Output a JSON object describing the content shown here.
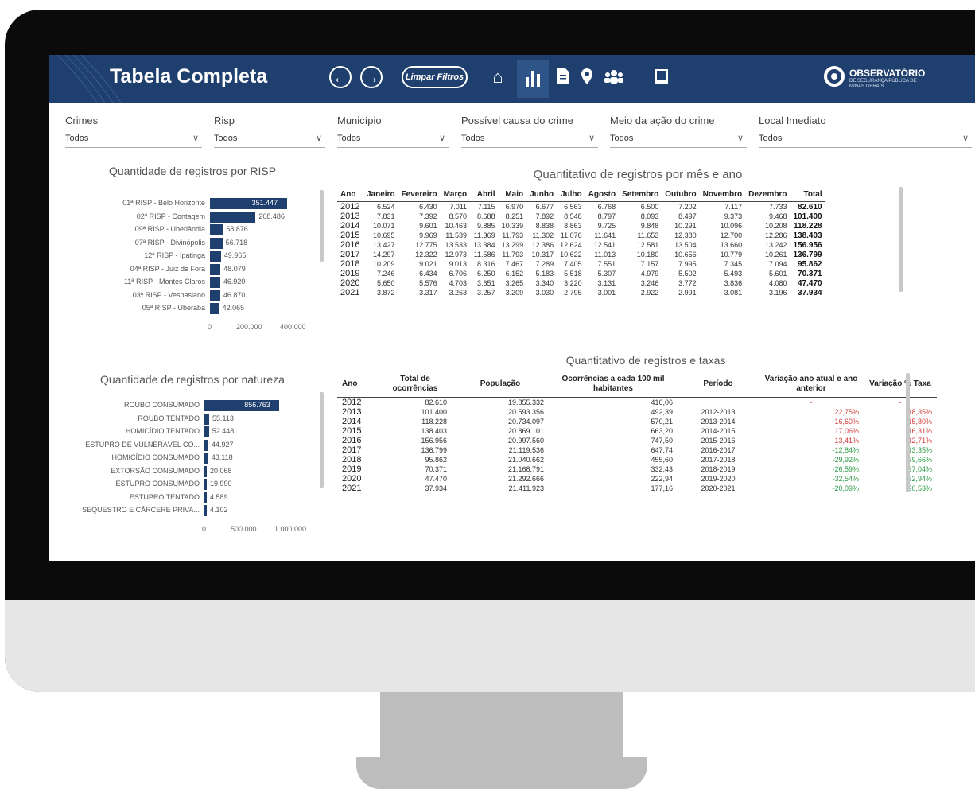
{
  "header": {
    "title": "Tabela Completa",
    "back_icon": "arrow-left-icon",
    "forward_icon": "arrow-right-icon",
    "clear_filters_label": "Limpar Filtros",
    "nav_icons": [
      "home-icon",
      "bar-chart-icon",
      "document-icon",
      "map-pin-icon",
      "people-icon",
      "book-icon"
    ],
    "brand_name": "OBSERVATÓRIO",
    "brand_sub": "DE SEGURANÇA PÚBLICA DE MINAS GERAIS",
    "colors": {
      "header_bg": "#1f3f6e",
      "bar": "#1f3f6e",
      "negative": "#2e9a45",
      "positive": "#d23a3a"
    }
  },
  "filters": [
    {
      "label": "Crimes",
      "value": "Todos"
    },
    {
      "label": "Risp",
      "value": "Todos"
    },
    {
      "label": "Município",
      "value": "Todos"
    },
    {
      "label": "Possível causa do crime",
      "value": "Todos"
    },
    {
      "label": "Meio da ação do crime",
      "value": "Todos"
    },
    {
      "label": "Local Imediato",
      "value": "Todos"
    }
  ],
  "chart_data": [
    {
      "type": "bar",
      "title": "Quantidade de registros por RISP",
      "orientation": "horizontal",
      "categories": [
        "01ª RISP - Belo Horizonte",
        "02ª RISP - Contagem",
        "09ª RISP - Uberlândia",
        "07ª RISP - Divinópolis",
        "12ª RISP - Ipatinga",
        "04ª RISP - Juiz de Fora",
        "11ª RISP - Montes Claros",
        "03ª RISP - Vespasiano",
        "05ª RISP - Uberaba"
      ],
      "values": [
        351447,
        208486,
        58876,
        56718,
        49965,
        48079,
        46920,
        46870,
        42065
      ],
      "value_labels": [
        "351.447",
        "208.486",
        "58.876",
        "56.718",
        "49.965",
        "48.079",
        "46.920",
        "46.870",
        "42.065"
      ],
      "xlim": [
        0,
        400000
      ],
      "ticks": [
        "0",
        "200.000",
        "400.000"
      ]
    },
    {
      "type": "bar",
      "title": "Quantidade de registros por natureza",
      "orientation": "horizontal",
      "categories": [
        "ROUBO CONSUMADO",
        "ROUBO TENTADO",
        "HOMICÍDIO TENTADO",
        "ESTUPRO DE VULNERÁVEL CO...",
        "HOMICÍDIO CONSUMADO",
        "EXTORSÃO CONSUMADO",
        "ESTUPRO CONSUMADO",
        "ESTUPRO TENTADO",
        "SEQUESTRO E CÁRCERE PRIVA..."
      ],
      "values": [
        856763,
        55113,
        52448,
        44927,
        43118,
        20068,
        19990,
        4589,
        4102
      ],
      "value_labels": [
        "856.763",
        "55.113",
        "52.448",
        "44.927",
        "43.118",
        "20.068",
        "19.990",
        "4.589",
        "4.102"
      ],
      "xlim": [
        0,
        1000000
      ],
      "ticks": [
        "0",
        "500.000",
        "1.000.000"
      ]
    }
  ],
  "month_table": {
    "title": "Quantitativo de registros por mês e ano",
    "headers": [
      "Ano",
      "Janeiro",
      "Fevereiro",
      "Março",
      "Abril",
      "Maio",
      "Junho",
      "Julho",
      "Agosto",
      "Setembro",
      "Outubro",
      "Novembro",
      "Dezembro",
      "Total"
    ],
    "rows": [
      [
        "2012",
        "6.524",
        "6.430",
        "7.011",
        "7.115",
        "6.970",
        "6.677",
        "6.563",
        "6.768",
        "6.500",
        "7.202",
        "7.117",
        "7.733",
        "82.610"
      ],
      [
        "2013",
        "7.831",
        "7.392",
        "8.570",
        "8.688",
        "8.251",
        "7.892",
        "8.548",
        "8.797",
        "8.093",
        "8.497",
        "9.373",
        "9.468",
        "101.400"
      ],
      [
        "2014",
        "10.071",
        "9.601",
        "10.463",
        "9.885",
        "10.339",
        "8.838",
        "8.863",
        "9.725",
        "9.848",
        "10.291",
        "10.096",
        "10.208",
        "118.228"
      ],
      [
        "2015",
        "10.695",
        "9.969",
        "11.539",
        "11.369",
        "11.793",
        "11.302",
        "11.076",
        "11.641",
        "11.653",
        "12.380",
        "12.700",
        "12.286",
        "138.403"
      ],
      [
        "2016",
        "13.427",
        "12.775",
        "13.533",
        "13.384",
        "13.299",
        "12.386",
        "12.624",
        "12.541",
        "12.581",
        "13.504",
        "13.660",
        "13.242",
        "156.956"
      ],
      [
        "2017",
        "14.297",
        "12.322",
        "12.973",
        "11.586",
        "11.793",
        "10.317",
        "10.622",
        "11.013",
        "10.180",
        "10.656",
        "10.779",
        "10.261",
        "136.799"
      ],
      [
        "2018",
        "10.209",
        "9.021",
        "9.013",
        "8.316",
        "7.467",
        "7.289",
        "7.405",
        "7.551",
        "7.157",
        "7.995",
        "7.345",
        "7.094",
        "95.862"
      ],
      [
        "2019",
        "7.246",
        "6.434",
        "6.706",
        "6.250",
        "6.152",
        "5.183",
        "5.518",
        "5.307",
        "4.979",
        "5.502",
        "5.493",
        "5.601",
        "70.371"
      ],
      [
        "2020",
        "5.650",
        "5.576",
        "4.703",
        "3.651",
        "3.265",
        "3.340",
        "3.220",
        "3.131",
        "3.246",
        "3.772",
        "3.836",
        "4.080",
        "47.470"
      ],
      [
        "2021",
        "3.872",
        "3.317",
        "3.263",
        "3.257",
        "3.209",
        "3.030",
        "2.795",
        "3.001",
        "2.922",
        "2.991",
        "3.081",
        "3.196",
        "37.934"
      ]
    ]
  },
  "rate_table": {
    "title": "Quantitativo de registros e taxas",
    "headers": [
      "Ano",
      "Total de ocorrências",
      "População",
      "Ocorrências a cada 100 mil habitantes",
      "Período",
      "Variação ano atual e ano anterior",
      "Variação % Taxa"
    ],
    "rows": [
      [
        "2012",
        "82.610",
        "19.855.332",
        "416,06",
        "",
        "-",
        "-"
      ],
      [
        "2013",
        "101.400",
        "20.593.356",
        "492,39",
        "2012-2013",
        "22,75%",
        "18,35%"
      ],
      [
        "2014",
        "118.228",
        "20.734.097",
        "570,21",
        "2013-2014",
        "16,60%",
        "15,80%"
      ],
      [
        "2015",
        "138.403",
        "20.869.101",
        "663,20",
        "2014-2015",
        "17,06%",
        "16,31%"
      ],
      [
        "2016",
        "156.956",
        "20.997.560",
        "747,50",
        "2015-2016",
        "13,41%",
        "12,71%"
      ],
      [
        "2017",
        "136.799",
        "21.119.536",
        "647,74",
        "2016-2017",
        "-12,84%",
        "-13,35%"
      ],
      [
        "2018",
        "95.862",
        "21.040.662",
        "455,60",
        "2017-2018",
        "-29,92%",
        "-29,66%"
      ],
      [
        "2019",
        "70.371",
        "21.168.791",
        "332,43",
        "2018-2019",
        "-26,59%",
        "-27,04%"
      ],
      [
        "2020",
        "47.470",
        "21.292.666",
        "222,94",
        "2019-2020",
        "-32,54%",
        "-32,94%"
      ],
      [
        "2021",
        "37.934",
        "21.411.923",
        "177,16",
        "2020-2021",
        "-20,09%",
        "-20,53%"
      ]
    ]
  }
}
